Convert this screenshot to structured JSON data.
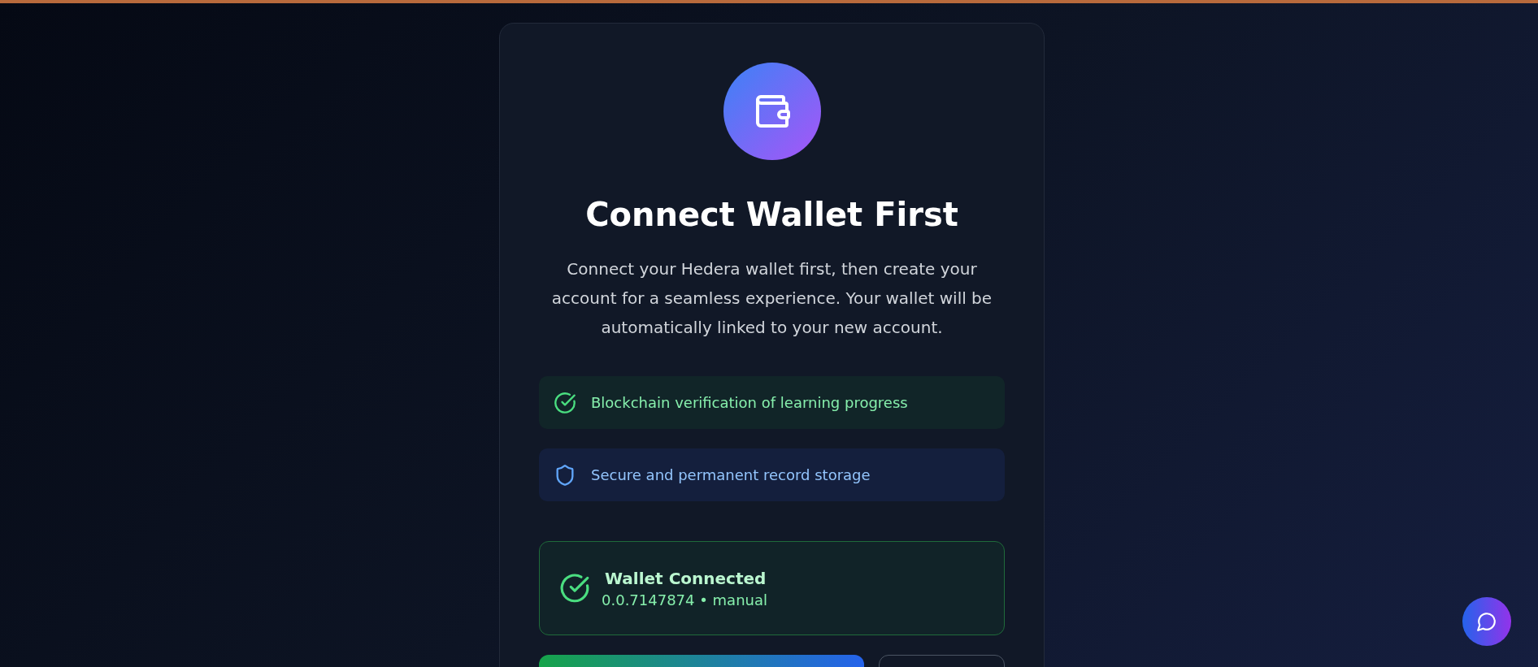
{
  "card": {
    "title": "Connect Wallet First",
    "description": "Connect your Hedera wallet first, then create your account for a seamless experience. Your wallet will be automatically linked to your new account.",
    "features": [
      {
        "kind": "check",
        "text": "Blockchain verification of learning progress"
      },
      {
        "kind": "shield",
        "text": "Secure and permanent record storage"
      }
    ],
    "wallet_status": {
      "title": "Wallet Connected",
      "detail": "0.0.7147874 • manual"
    }
  }
}
